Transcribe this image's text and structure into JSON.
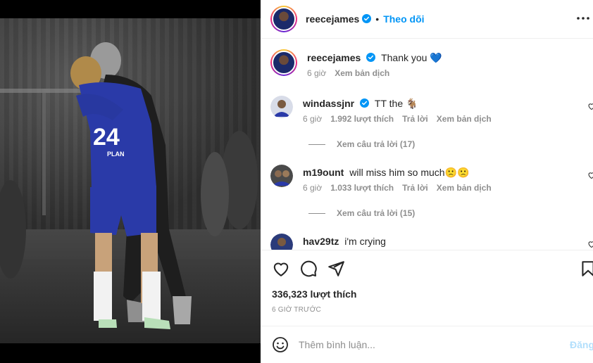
{
  "header": {
    "username": "reecejames",
    "separator": "•",
    "follow_label": "Theo dõi"
  },
  "caption": {
    "username": "reecejames",
    "text": "Thank you",
    "emoji": "💙",
    "time": "6 giờ",
    "translate": "Xem bản dịch"
  },
  "comments": [
    {
      "username": "windassjnr",
      "verified": true,
      "text": "TT the 🐐",
      "time": "6 giờ",
      "likes": "1.992 lượt thích",
      "reply": "Trả lời",
      "translate": "Xem bản dịch",
      "view_replies": "Xem câu trả lời (17)"
    },
    {
      "username": "m19ount",
      "verified": false,
      "text": "will miss him so much🙁🙁",
      "time": "6 giờ",
      "likes": "1.033 lượt thích",
      "reply": "Trả lời",
      "translate": "Xem bản dịch",
      "view_replies": "Xem câu trả lời (15)"
    },
    {
      "username": "hav29tz",
      "verified": false,
      "text": "i'm crying"
    }
  ],
  "actions": {
    "like_icon": "heart-icon",
    "comment_icon": "comment-bubble-icon",
    "share_icon": "send-icon",
    "save_icon": "bookmark-icon"
  },
  "likes": "336,323 lượt thích",
  "timestamp": "6 GIỜ TRƯỚC",
  "comment_box": {
    "placeholder": "Thêm bình luận...",
    "post_label": "Đăng"
  },
  "photo": {
    "jersey_number": "24",
    "sponsor": "PLAN"
  },
  "colors": {
    "accent": "#0095f6",
    "post_disabled": "#b2dffc",
    "verified": "#0095f6",
    "jersey": "#2a3aa8"
  }
}
